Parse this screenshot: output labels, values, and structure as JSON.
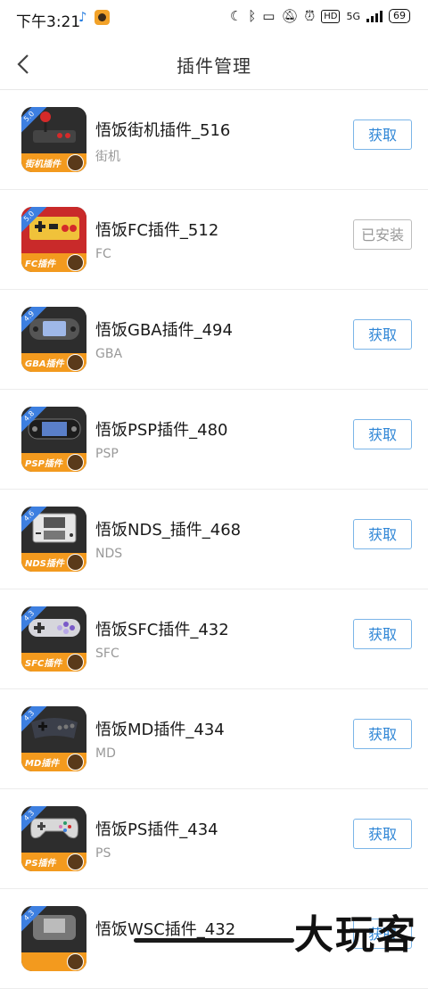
{
  "status_bar": {
    "time": "下午3:21",
    "note_icon": "music-note-icon",
    "app_icon": "wufan-app-icon",
    "right_icons": [
      "moon-icon",
      "bluetooth-icon",
      "vibrate-icon",
      "mute-icon",
      "alarm-icon",
      "hd-icon",
      "signal-icon",
      "battery-icon"
    ],
    "hd": "HD",
    "network": "5G",
    "battery": "69"
  },
  "header": {
    "title": "插件管理",
    "back_icon": "chevron-left-icon"
  },
  "plugins": [
    {
      "name": "悟饭街机插件_516",
      "sub": "街机",
      "band": "街机插件",
      "rating": "5.0",
      "button": "获取",
      "installed": false,
      "device": "arcade-joystick-icon",
      "colors": {
        "art": "#2d2d2d"
      }
    },
    {
      "name": "悟饭FC插件_512",
      "sub": "FC",
      "band": "FC插件",
      "rating": "5.0",
      "button": "已安装",
      "installed": true,
      "device": "fc-controller-icon",
      "colors": {
        "art": "#c92a2a"
      }
    },
    {
      "name": "悟饭GBA插件_494",
      "sub": "GBA",
      "band": "GBA插件",
      "rating": "4.9",
      "button": "获取",
      "installed": false,
      "device": "gba-console-icon",
      "colors": {
        "art": "#2d2d2d"
      }
    },
    {
      "name": "悟饭PSP插件_480",
      "sub": "PSP",
      "band": "PSP插件",
      "rating": "4.8",
      "button": "获取",
      "installed": false,
      "device": "psp-console-icon",
      "colors": {
        "art": "#2d2d2d"
      }
    },
    {
      "name": "悟饭NDS_插件_468",
      "sub": "NDS",
      "band": "NDS插件",
      "rating": "4.6",
      "button": "获取",
      "installed": false,
      "device": "nds-console-icon",
      "colors": {
        "art": "#2d2d2d"
      }
    },
    {
      "name": "悟饭SFC插件_432",
      "sub": "SFC",
      "band": "SFC插件",
      "rating": "4.3",
      "button": "获取",
      "installed": false,
      "device": "sfc-controller-icon",
      "colors": {
        "art": "#2d2d2d"
      }
    },
    {
      "name": "悟饭MD插件_434",
      "sub": "MD",
      "band": "MD插件",
      "rating": "4.3",
      "button": "获取",
      "installed": false,
      "device": "md-controller-icon",
      "colors": {
        "art": "#2d2d2d"
      }
    },
    {
      "name": "悟饭PS插件_434",
      "sub": "PS",
      "band": "PS插件",
      "rating": "4.3",
      "button": "获取",
      "installed": false,
      "device": "ps-controller-icon",
      "colors": {
        "art": "#2d2d2d"
      }
    },
    {
      "name": "悟饭WSC插件_432",
      "sub": "",
      "band": "",
      "rating": "4.3",
      "button": "获取",
      "installed": false,
      "device": "wsc-console-icon",
      "colors": {
        "art": "#2d2d2d"
      }
    }
  ],
  "watermark": "大玩客",
  "theme": {
    "accent": "#2f86d6",
    "band": "#f39a1e",
    "ribbon": "#3d7fe0"
  }
}
